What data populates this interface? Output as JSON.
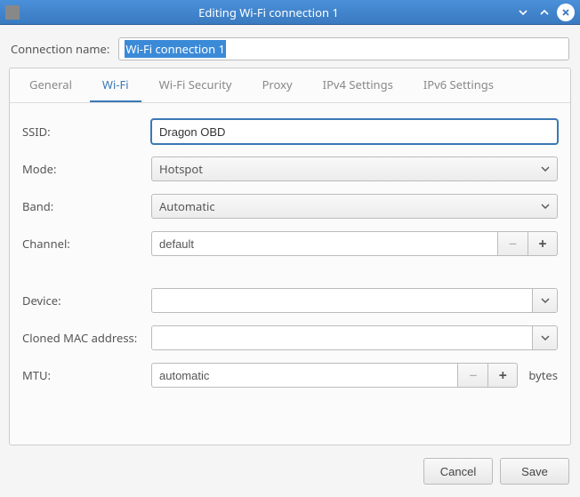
{
  "window": {
    "title": "Editing Wi-Fi connection 1"
  },
  "form": {
    "connection_name_label": "Connection name:",
    "connection_name_value": "Wi-Fi connection 1"
  },
  "tabs": {
    "general": "General",
    "wifi": "Wi-Fi",
    "wifi_security": "Wi-Fi Security",
    "proxy": "Proxy",
    "ipv4": "IPv4 Settings",
    "ipv6": "IPv6 Settings"
  },
  "wifi": {
    "ssid_label": "SSID:",
    "ssid_value": "Dragon OBD",
    "mode_label": "Mode:",
    "mode_value": "Hotspot",
    "band_label": "Band:",
    "band_value": "Automatic",
    "channel_label": "Channel:",
    "channel_value": "default",
    "device_label": "Device:",
    "device_value": "",
    "cloned_mac_label": "Cloned MAC address:",
    "cloned_mac_value": "",
    "mtu_label": "MTU:",
    "mtu_value": "automatic",
    "mtu_suffix": "bytes"
  },
  "buttons": {
    "minus": "−",
    "plus": "+",
    "cancel": "Cancel",
    "save": "Save"
  }
}
